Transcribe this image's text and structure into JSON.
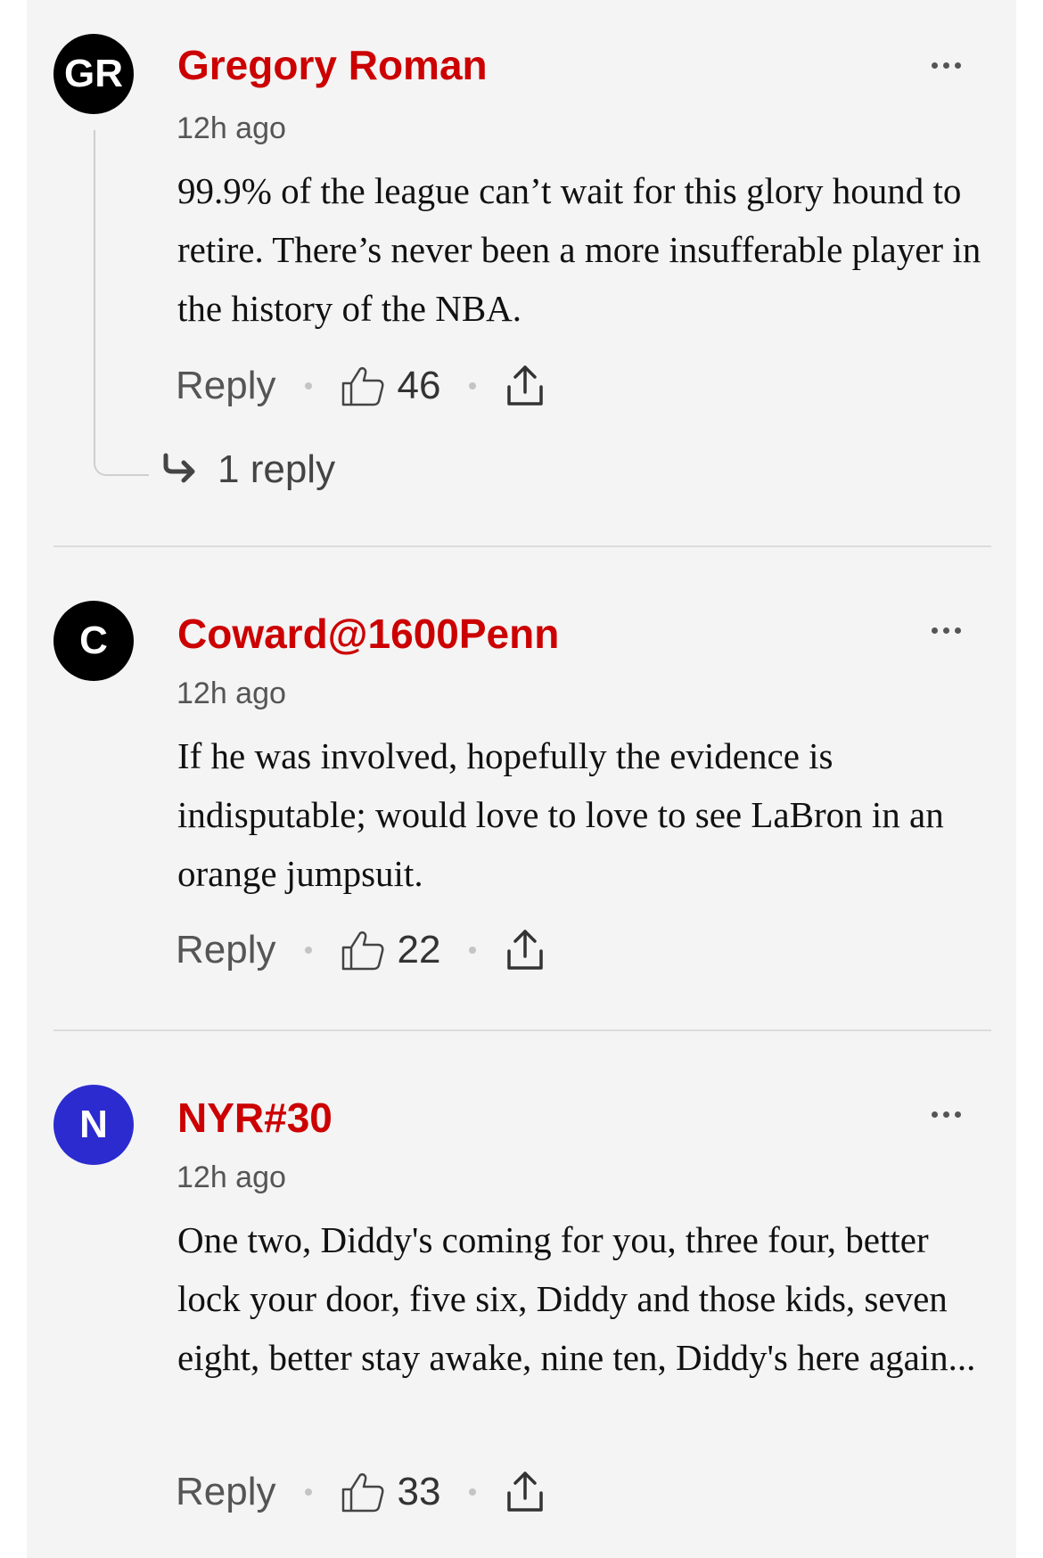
{
  "comments": [
    {
      "initials": "GR",
      "avatar_color": "#000000",
      "author": "Gregory Roman",
      "time": "12h ago",
      "body": "99.9% of the league can’t wait for this glory hound to retire. There’s never been a more insufferable player in the history of the NBA.",
      "reply_label": "Reply",
      "likes": "46",
      "replies_label": "1 reply"
    },
    {
      "initials": "C",
      "avatar_color": "#000000",
      "author": "Coward@1600Penn",
      "time": "12h ago",
      "body": "If he was involved, hopefully the evidence is indisputable; would love to love to see LaBron in an orange jumpsuit.",
      "reply_label": "Reply",
      "likes": "22"
    },
    {
      "initials": "N",
      "avatar_color": "#2b2bd0",
      "author": "NYR#30",
      "time": "12h ago",
      "body": "One two, Diddy's coming for you, three four, better lock your door, five six, Diddy and those kids, seven eight, better stay awake, nine ten, Diddy's here again...",
      "reply_label": "Reply",
      "likes": "33"
    }
  ],
  "colors": {
    "author": "#cc0000",
    "background": "#f4f4f4",
    "meta": "#555555"
  },
  "icons": [
    "more-options-icon",
    "thumbs-up-icon",
    "share-icon",
    "reply-arrow-icon"
  ]
}
